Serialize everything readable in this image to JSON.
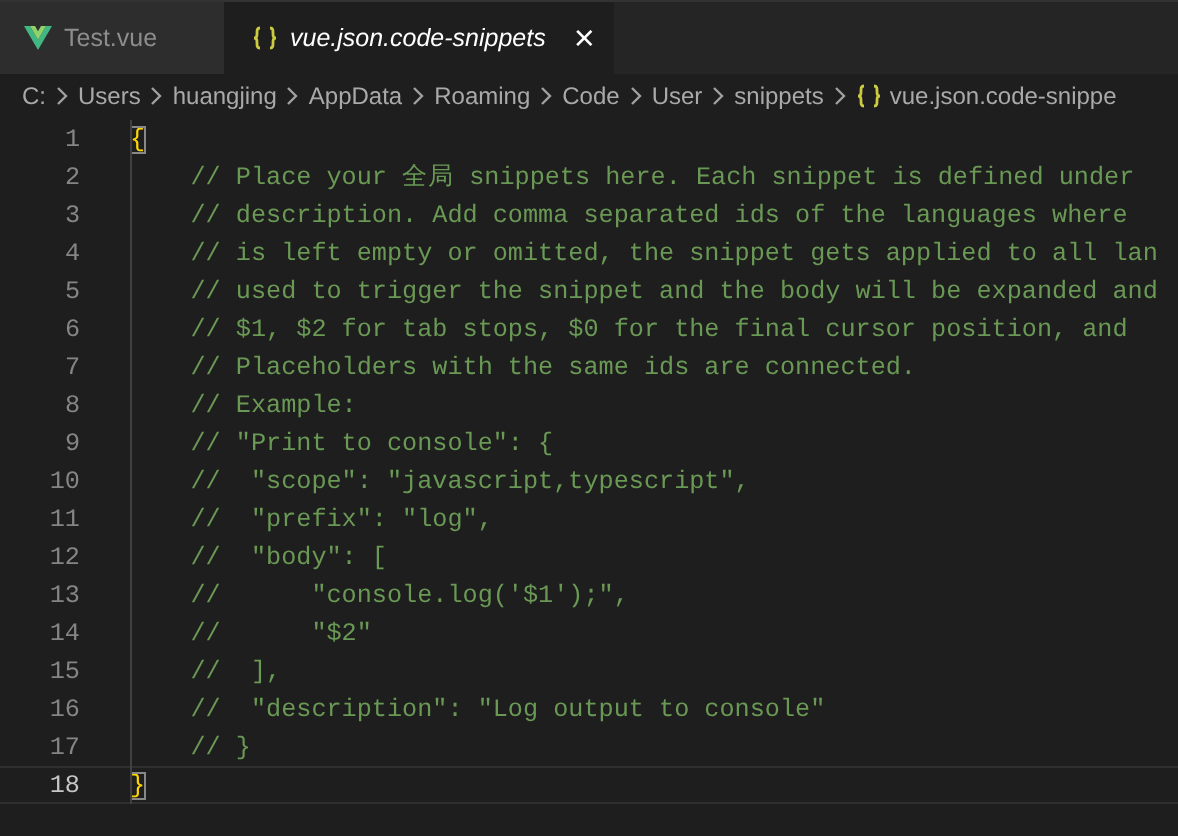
{
  "tabs": [
    {
      "label": "Test.vue",
      "kind": "vue",
      "selected": false,
      "preview": false
    },
    {
      "label": "vue.json.code-snippets",
      "kind": "braces",
      "selected": true,
      "preview": true
    }
  ],
  "close_symbol": "×",
  "breadcrumbs": [
    {
      "label": "C:"
    },
    {
      "label": "Users"
    },
    {
      "label": "huangjing"
    },
    {
      "label": "AppData"
    },
    {
      "label": "Roaming"
    },
    {
      "label": "Code"
    },
    {
      "label": "User"
    },
    {
      "label": "snippets"
    },
    {
      "label": "vue.json.code-snippe",
      "kind": "braces"
    }
  ],
  "lines": [
    {
      "number": "1",
      "kind": "brace",
      "text": "{",
      "current": false,
      "bracket_match": true
    },
    {
      "number": "2",
      "kind": "comment",
      "text": "    // Place your 全局 snippets here. Each snippet is defined under",
      "current": false
    },
    {
      "number": "3",
      "kind": "comment",
      "text": "    // description. Add comma separated ids of the languages where",
      "current": false
    },
    {
      "number": "4",
      "kind": "comment",
      "text": "    // is left empty or omitted, the snippet gets applied to all lan",
      "current": false
    },
    {
      "number": "5",
      "kind": "comment",
      "text": "    // used to trigger the snippet and the body will be expanded and",
      "current": false
    },
    {
      "number": "6",
      "kind": "comment",
      "text": "    // $1, $2 for tab stops, $0 for the final cursor position, and",
      "current": false
    },
    {
      "number": "7",
      "kind": "comment",
      "text": "    // Placeholders with the same ids are connected.",
      "current": false
    },
    {
      "number": "8",
      "kind": "comment",
      "text": "    // Example:",
      "current": false
    },
    {
      "number": "9",
      "kind": "comment",
      "text": "    // \"Print to console\": {",
      "current": false
    },
    {
      "number": "10",
      "kind": "comment",
      "text": "    //  \"scope\": \"javascript,typescript\",",
      "current": false
    },
    {
      "number": "11",
      "kind": "comment",
      "text": "    //  \"prefix\": \"log\",",
      "current": false
    },
    {
      "number": "12",
      "kind": "comment",
      "text": "    //  \"body\": [",
      "current": false
    },
    {
      "number": "13",
      "kind": "comment",
      "text": "    //      \"console.log('$1');\",",
      "current": false
    },
    {
      "number": "14",
      "kind": "comment",
      "text": "    //      \"$2\"",
      "current": false
    },
    {
      "number": "15",
      "kind": "comment",
      "text": "    //  ],",
      "current": false
    },
    {
      "number": "16",
      "kind": "comment",
      "text": "    //  \"description\": \"Log output to console\"",
      "current": false
    },
    {
      "number": "17",
      "kind": "comment",
      "text": "    // }",
      "current": false
    },
    {
      "number": "18",
      "kind": "brace",
      "text": "}",
      "current": true,
      "bracket_match": true
    }
  ]
}
